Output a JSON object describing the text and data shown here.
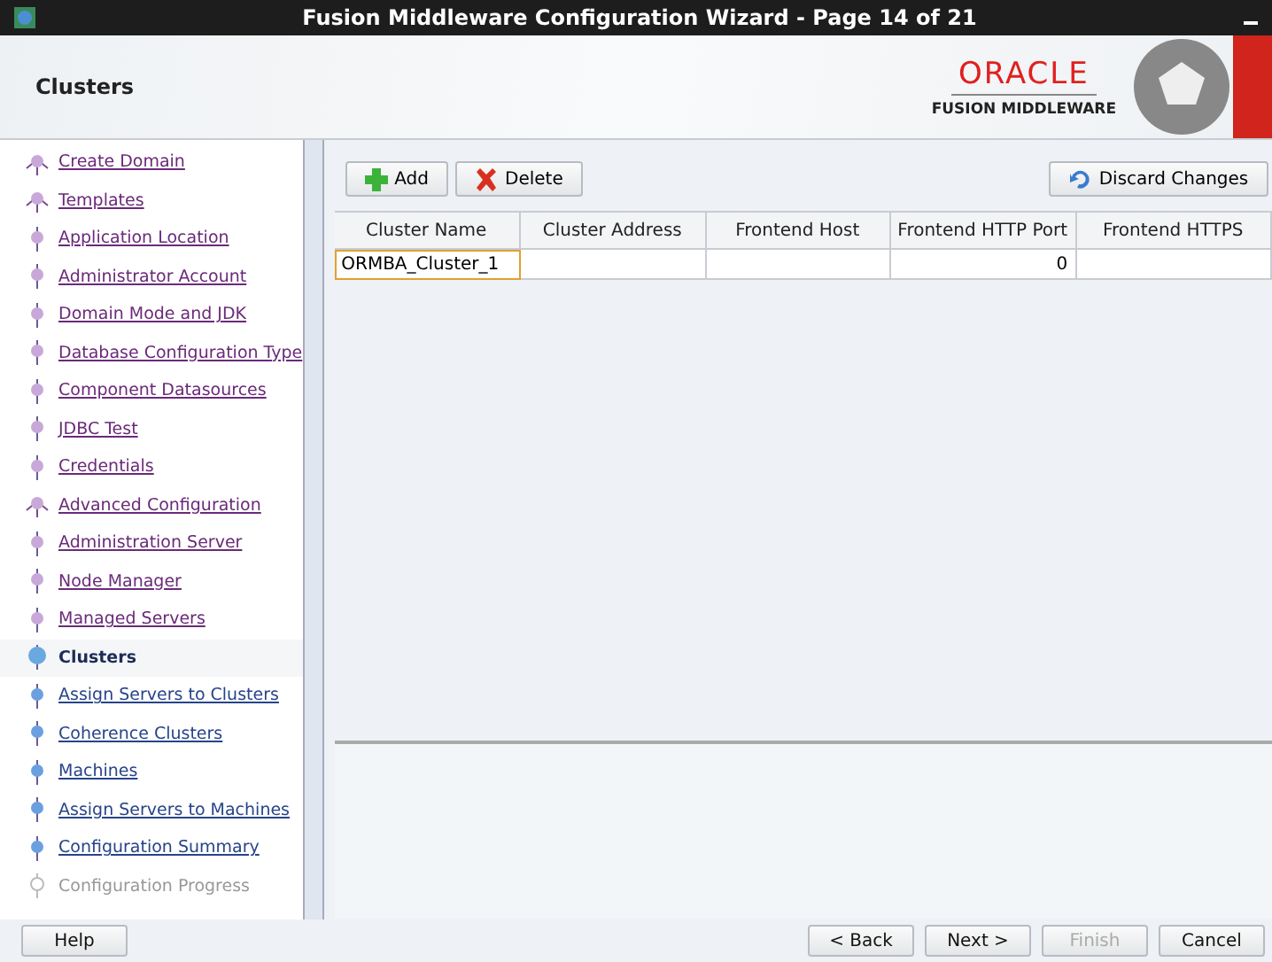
{
  "window": {
    "title": "Fusion Middleware Configuration Wizard - Page 14 of 21"
  },
  "header": {
    "title": "Clusters",
    "brand": "ORACLE",
    "product": "FUSION MIDDLEWARE"
  },
  "steps": [
    {
      "label": "Create Domain",
      "kind": "visited",
      "group_start": true
    },
    {
      "label": "Templates",
      "kind": "visited",
      "group_start": true
    },
    {
      "label": "Application Location",
      "kind": "visited",
      "group_start": false
    },
    {
      "label": "Administrator Account",
      "kind": "visited",
      "group_start": false
    },
    {
      "label": "Domain Mode and JDK",
      "kind": "visited",
      "group_start": false
    },
    {
      "label": "Database Configuration Type",
      "kind": "visited",
      "group_start": false
    },
    {
      "label": "Component Datasources",
      "kind": "visited",
      "group_start": false
    },
    {
      "label": "JDBC Test",
      "kind": "visited",
      "group_start": false
    },
    {
      "label": "Credentials",
      "kind": "visited",
      "group_start": false
    },
    {
      "label": "Advanced Configuration",
      "kind": "visited",
      "group_start": true
    },
    {
      "label": "Administration Server",
      "kind": "visited",
      "group_start": false
    },
    {
      "label": "Node Manager",
      "kind": "visited",
      "group_start": false
    },
    {
      "label": "Managed Servers",
      "kind": "visited",
      "group_start": false
    },
    {
      "label": "Clusters",
      "kind": "current",
      "group_start": false
    },
    {
      "label": "Assign Servers to Clusters",
      "kind": "pending",
      "group_start": false
    },
    {
      "label": "Coherence Clusters",
      "kind": "pending",
      "group_start": false
    },
    {
      "label": "Machines",
      "kind": "pending",
      "group_start": false
    },
    {
      "label": "Assign Servers to Machines",
      "kind": "pending",
      "group_start": false
    },
    {
      "label": "Configuration Summary",
      "kind": "pending",
      "group_start": false
    },
    {
      "label": "Configuration Progress",
      "kind": "unavailable",
      "group_start": false
    }
  ],
  "toolbar": [
    {
      "label": "Add",
      "kind": "add"
    },
    {
      "label": "Delete",
      "kind": "delete"
    },
    {
      "label": "Discard Changes",
      "kind": "discard"
    }
  ],
  "table": {
    "columns": [
      "Cluster Name",
      "Cluster Address",
      "Frontend Host",
      "Frontend HTTP Port",
      "Frontend HTTPS"
    ],
    "rows": [
      {
        "cells": [
          "ORMBA_Cluster_1",
          "",
          "",
          "0",
          ""
        ],
        "selected": true
      }
    ]
  },
  "buttons": [
    {
      "label": "Help",
      "disabled": false
    },
    {
      "label": "< Back",
      "disabled": false
    },
    {
      "label": "Next >",
      "disabled": false
    },
    {
      "label": "Finish",
      "disabled": true
    },
    {
      "label": "Cancel",
      "disabled": false
    }
  ]
}
